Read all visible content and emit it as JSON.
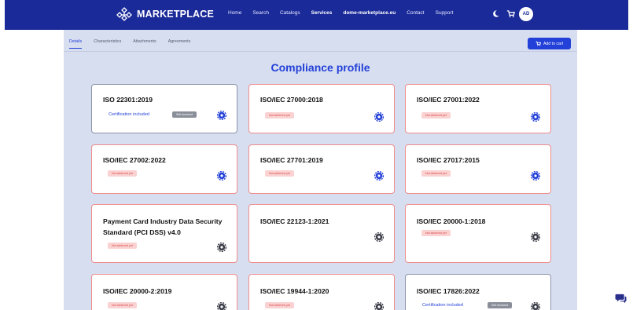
{
  "header": {
    "logo_text": "MARKETPLACE",
    "nav": [
      "Home",
      "Search",
      "Catalogs",
      "Services",
      "dome-marketplace.eu",
      "Contact",
      "Support"
    ],
    "active_nav": "Services",
    "avatar_initials": "AD",
    "icons": [
      "moon-icon",
      "cart-icon"
    ]
  },
  "tabs": [
    "Details",
    "Characteristics",
    "Attachments",
    "Agreements"
  ],
  "active_tab": "Details",
  "add_to_cart_label": "Add to cart",
  "page_title": "Compliance profile",
  "cards": [
    {
      "title": "ISO 22301:2019",
      "status": "certified",
      "cert_label": "Certification included",
      "badge": "Self declared"
    },
    {
      "title": "ISO/IEC 27000:2018",
      "status": "not",
      "badge": "Not achieved yet"
    },
    {
      "title": "ISO/IEC 27001:2022",
      "status": "not",
      "badge": "Not achieved yet"
    },
    {
      "title": "ISO/IEC 27002:2022",
      "status": "not",
      "badge": "Not achieved yet"
    },
    {
      "title": "ISO/IEC 27701:2019",
      "status": "not",
      "badge": "Not achieved yet"
    },
    {
      "title": "ISO/IEC 27017:2015",
      "status": "not",
      "badge": "Not achieved yet"
    },
    {
      "title": "Payment Card Industry Data Security Standard (PCI DSS) v4.0",
      "status": "not",
      "badge": "Not achieved yet"
    },
    {
      "title": "ISO/IEC 22123-1:2021",
      "status": "not",
      "badge": "Not achieved yet"
    },
    {
      "title": "ISO/IEC 20000-1:2018",
      "status": "not",
      "badge": "Not achieved yet"
    },
    {
      "title": "ISO/IEC 20000-2:2019",
      "status": "not",
      "badge": "Not achieved yet"
    },
    {
      "title": "ISO/IEC 19944-1:2020",
      "status": "not",
      "badge": "Not achieved yet"
    },
    {
      "title": "ISO/IEC 17826:2022",
      "status": "certified",
      "cert_label": "Certification included",
      "badge": "Self declared"
    }
  ],
  "colors": {
    "brand": "#1a2a99",
    "accent": "#2340d8",
    "page_bg": "#d7def0",
    "error": "#ef8c8c"
  }
}
